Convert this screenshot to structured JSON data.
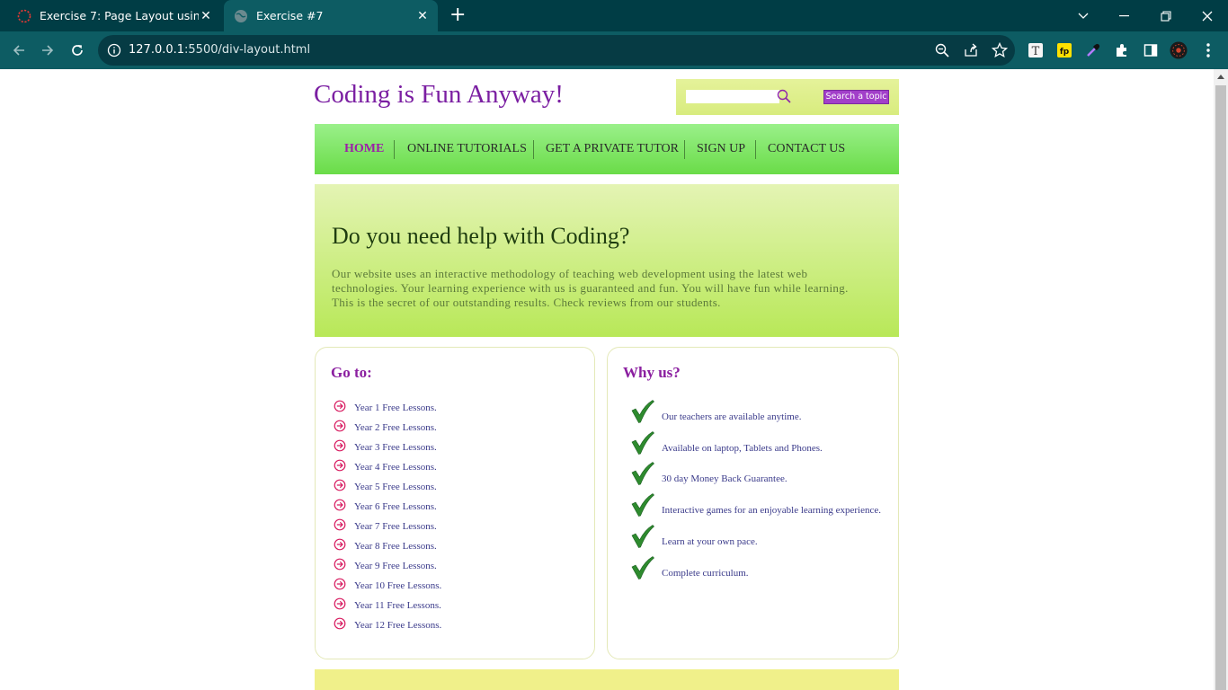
{
  "browser": {
    "tabs": [
      {
        "title": "Exercise 7: Page Layout using Div",
        "active": false
      },
      {
        "title": "Exercise #7",
        "active": true
      }
    ],
    "url_host": "127.0.0.1",
    "url_rest": ":5500/div-layout.html"
  },
  "site": {
    "title": "Coding is Fun Anyway!",
    "search": {
      "placeholder": "",
      "button_label": "Search a topic"
    },
    "nav": [
      "HOME",
      "ONLINE TUTORIALS",
      "GET A PRIVATE TUTOR",
      "SIGN UP",
      "CONTACT US"
    ],
    "hero": {
      "title": "Do you need help with Coding?",
      "text": "Our website uses an interactive methodology of teaching web development using the latest web technologies. Your learning experience with us is guaranteed and fun. You will have fun while learning. This is the secret of our outstanding results. Check reviews from our students."
    },
    "goto": {
      "title": "Go to:",
      "items": [
        "Year 1 Free Lessons.",
        "Year 2 Free Lessons.",
        "Year 3 Free Lessons.",
        "Year 4 Free Lessons.",
        "Year 5 Free Lessons.",
        "Year 6 Free Lessons.",
        "Year 7 Free Lessons.",
        "Year 8 Free Lessons.",
        "Year 9 Free Lessons.",
        "Year 10 Free Lessons.",
        "Year 11 Free Lessons.",
        "Year 12 Free Lessons."
      ]
    },
    "whyus": {
      "title": "Why us?",
      "items": [
        "Our teachers are available anytime.",
        "Available on laptop, Tablets and Phones.",
        "30 day Money Back Guarantee.",
        "Interactive games for an enjoyable learning experience.",
        "Learn at your own pace.",
        "Complete curriculum."
      ]
    }
  }
}
